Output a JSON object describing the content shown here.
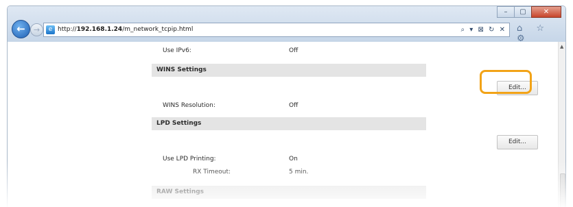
{
  "browser": {
    "window_buttons": {
      "minimize": "–",
      "maximize": "▢",
      "close": "✕"
    },
    "url_prefix": "http://",
    "url_host": "192.168.1.24",
    "url_path": "/m_network_tcpip.html",
    "address_tools": "⌕ ▾ ⊠ ↻ ✕",
    "toolbar_icons": "⌂ ☆ ⚙"
  },
  "page": {
    "rows": [
      {
        "label": "Use IPv6:",
        "value": "Off"
      },
      {
        "label": "WINS Resolution:",
        "value": "Off"
      },
      {
        "label": "Use LPD Printing:",
        "value": "On"
      },
      {
        "label": "RX Timeout:",
        "value": "5 min."
      }
    ],
    "sections": [
      {
        "title": "WINS Settings",
        "edit_label": "Edit..."
      },
      {
        "title": "LPD Settings",
        "edit_label": "Edit..."
      },
      {
        "title": "RAW Settings"
      }
    ]
  },
  "colors": {
    "highlight": "#f2a317",
    "section_bg": "#e4e4e4"
  }
}
